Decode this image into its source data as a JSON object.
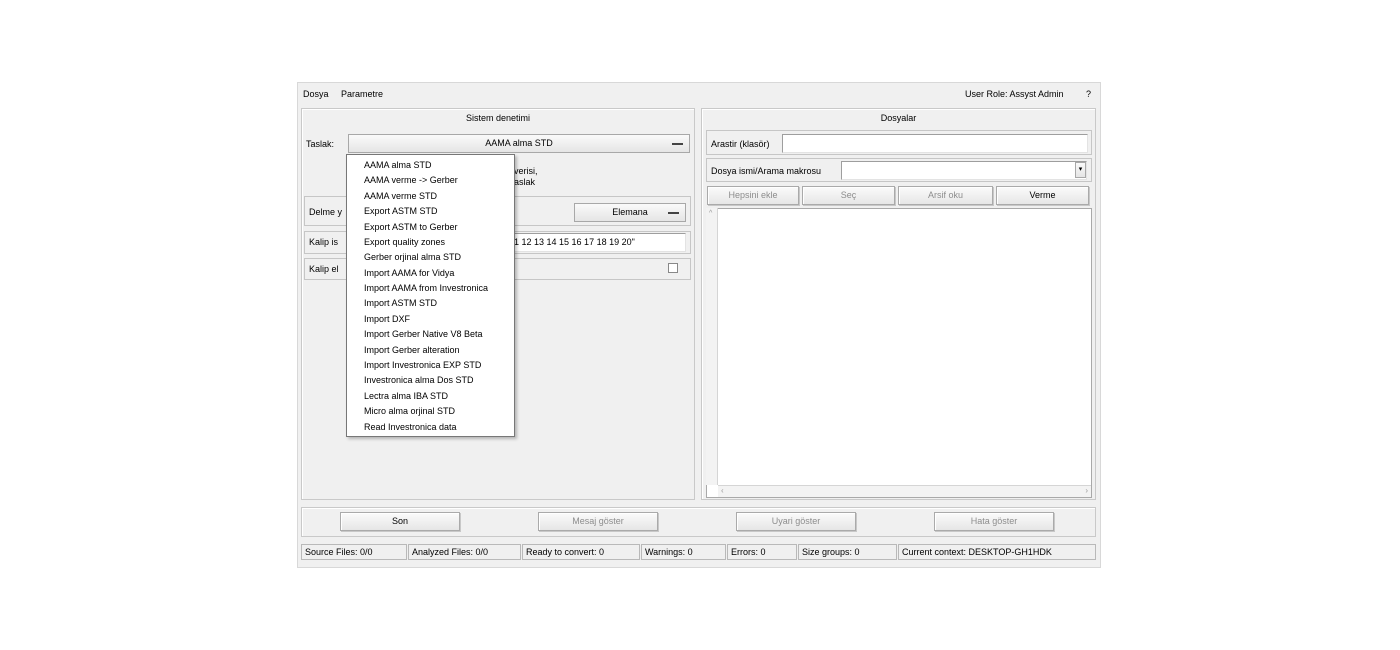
{
  "menubar": {
    "file": "Dosya",
    "params": "Parametre",
    "user_role": "User Role: Assyst Admin",
    "help": "?"
  },
  "left_panel": {
    "title": "Sistem denetimi",
    "template_label": "Taslak:",
    "template_value": "AAMA alma STD",
    "partial_text_1": "verisi,",
    "partial_text_2": "aslak",
    "delete_label": "Delme y",
    "element_button": "Elemana",
    "pattern_name_label": "Kalip is",
    "pattern_name_value": "1 12 13 14 15 16 17 18 19 20\"",
    "pattern_add_label": "Kalip el"
  },
  "dropdown": {
    "items": [
      "AAMA alma STD",
      "AAMA verme  -> Gerber",
      "AAMA verme  STD",
      "Export ASTM STD",
      "Export ASTM to Gerber",
      "Export quality zones",
      "Gerber orjinal alma STD",
      "Import AAMA for Vidya",
      "Import AAMA from Investronica",
      "Import ASTM STD",
      "Import DXF",
      "Import Gerber Native V8 Beta",
      "Import Gerber alteration",
      "Import Investronica EXP STD",
      "Investronica alma Dos STD",
      "Lectra alma IBA STD",
      "Micro alma orjinal STD",
      "Read Investronica data"
    ]
  },
  "right_panel": {
    "title": "Dosyalar",
    "search_folder_label": "Arastir (klasör)",
    "search_folder_value": "",
    "filename_label": "Dosya ismi/Arama makrosu",
    "filename_value": "",
    "buttons": {
      "add_all": "Hepsini ekle",
      "select": "Seç",
      "read_archive": "Arsif oku",
      "give": "Verme"
    }
  },
  "bottom_buttons": {
    "end": "Son",
    "show_message": "Mesaj göster",
    "show_warning": "Uyari göster",
    "show_error": "Hata göster"
  },
  "statusbar": {
    "source_files": "Source Files: 0/0",
    "analyzed_files": "Analyzed Files: 0/0",
    "ready_to_convert": "Ready to convert: 0",
    "warnings": "Warnings: 0",
    "errors": "Errors: 0",
    "size_groups": "Size groups: 0",
    "current_context": "Current context: DESKTOP-GH1HDK"
  }
}
